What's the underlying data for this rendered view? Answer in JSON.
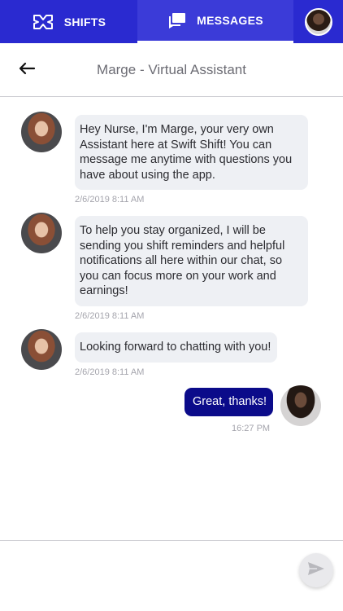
{
  "nav": {
    "shifts_label": "SHIFTS",
    "messages_label": "MESSAGES"
  },
  "header": {
    "title": "Marge - Virtual Assistant"
  },
  "messages": [
    {
      "from": "assistant",
      "text": "Hey Nurse, I'm Marge, your very own Assistant here at Swift Shift! You can message me anytime with questions you have about using the app.",
      "time": "2/6/2019 8:11 AM"
    },
    {
      "from": "assistant",
      "text": "To help you stay organized, I will be sending you shift reminders and helpful notifications all here within our chat, so you can focus more on your work and earnings!",
      "time": "2/6/2019 8:11 AM"
    },
    {
      "from": "assistant",
      "text": "Looking forward to chatting with you!",
      "time": "2/6/2019 8:11 AM"
    },
    {
      "from": "user",
      "text": "Great, thanks!",
      "time": "16:27 PM"
    }
  ],
  "composer": {
    "placeholder": "",
    "value": ""
  },
  "colors": {
    "nav_bg": "#2a2ad0",
    "user_bubble": "#0b0b8a",
    "assistant_bubble": "#eef0f4"
  },
  "icons": {
    "shifts": "shifts-icon",
    "messages": "messages-icon",
    "back": "back-arrow-icon",
    "send": "send-icon"
  }
}
